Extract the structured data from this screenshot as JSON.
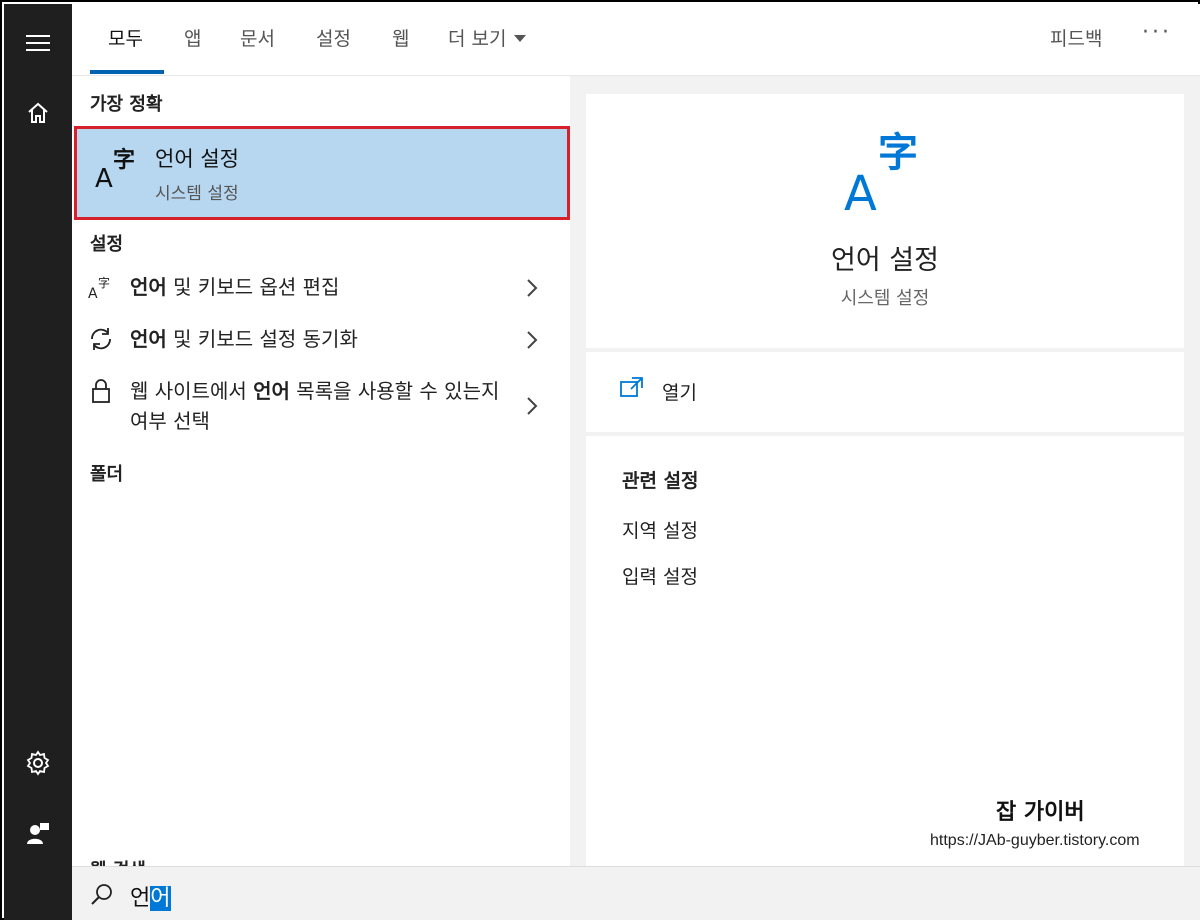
{
  "tabs": [
    {
      "label": "모두",
      "active": true
    },
    {
      "label": "앱"
    },
    {
      "label": "문서"
    },
    {
      "label": "설정"
    },
    {
      "label": "웹"
    },
    {
      "label": "더 보기"
    }
  ],
  "header": {
    "feedback": "피드백",
    "more": "···"
  },
  "best_match": {
    "heading": "가장 정확",
    "title": "언어 설정",
    "subtitle": "시스템 설정",
    "icon": "language-settings-icon"
  },
  "settings": {
    "heading": "설정",
    "items": [
      {
        "icon": "language-icon",
        "bold": "언어",
        "rest": " 및 키보드 옵션 편집"
      },
      {
        "icon": "sync-icon",
        "bold": "언어",
        "rest": " 및 키보드 설정 동기화"
      },
      {
        "icon": "lock-icon",
        "pre": "웹 사이트에서 ",
        "bold": "언어",
        "rest": " 목록을 사용할 수 있는지 여부 선택"
      }
    ]
  },
  "folders": {
    "heading": "폴더"
  },
  "cut_heading": "웹 검색",
  "detail": {
    "title": "언어 설정",
    "subtitle": "시스템 설정",
    "open_label": "열기",
    "related_heading": "관련 설정",
    "related": [
      "지역 설정",
      "입력 설정"
    ]
  },
  "watermark": {
    "title": "잡 가이버",
    "url": "https://JAb-guyber.tistory.com"
  },
  "search": {
    "typed": "언",
    "selected": "어"
  },
  "colors": {
    "accent": "#0063b1",
    "highlight": "#b7d7f1",
    "border_red": "#d6202a",
    "rail": "#1f1f1f"
  }
}
